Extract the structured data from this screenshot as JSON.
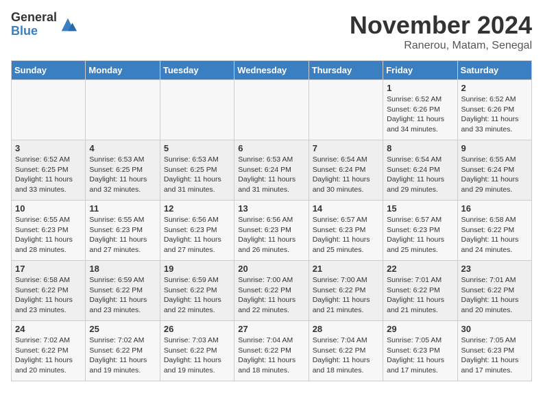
{
  "header": {
    "logo_general": "General",
    "logo_blue": "Blue",
    "month_year": "November 2024",
    "location": "Ranerou, Matam, Senegal"
  },
  "weekdays": [
    "Sunday",
    "Monday",
    "Tuesday",
    "Wednesday",
    "Thursday",
    "Friday",
    "Saturday"
  ],
  "weeks": [
    [
      {
        "day": "",
        "info": ""
      },
      {
        "day": "",
        "info": ""
      },
      {
        "day": "",
        "info": ""
      },
      {
        "day": "",
        "info": ""
      },
      {
        "day": "",
        "info": ""
      },
      {
        "day": "1",
        "info": "Sunrise: 6:52 AM\nSunset: 6:26 PM\nDaylight: 11 hours\nand 34 minutes."
      },
      {
        "day": "2",
        "info": "Sunrise: 6:52 AM\nSunset: 6:26 PM\nDaylight: 11 hours\nand 33 minutes."
      }
    ],
    [
      {
        "day": "3",
        "info": "Sunrise: 6:52 AM\nSunset: 6:25 PM\nDaylight: 11 hours\nand 33 minutes."
      },
      {
        "day": "4",
        "info": "Sunrise: 6:53 AM\nSunset: 6:25 PM\nDaylight: 11 hours\nand 32 minutes."
      },
      {
        "day": "5",
        "info": "Sunrise: 6:53 AM\nSunset: 6:25 PM\nDaylight: 11 hours\nand 31 minutes."
      },
      {
        "day": "6",
        "info": "Sunrise: 6:53 AM\nSunset: 6:24 PM\nDaylight: 11 hours\nand 31 minutes."
      },
      {
        "day": "7",
        "info": "Sunrise: 6:54 AM\nSunset: 6:24 PM\nDaylight: 11 hours\nand 30 minutes."
      },
      {
        "day": "8",
        "info": "Sunrise: 6:54 AM\nSunset: 6:24 PM\nDaylight: 11 hours\nand 29 minutes."
      },
      {
        "day": "9",
        "info": "Sunrise: 6:55 AM\nSunset: 6:24 PM\nDaylight: 11 hours\nand 29 minutes."
      }
    ],
    [
      {
        "day": "10",
        "info": "Sunrise: 6:55 AM\nSunset: 6:23 PM\nDaylight: 11 hours\nand 28 minutes."
      },
      {
        "day": "11",
        "info": "Sunrise: 6:55 AM\nSunset: 6:23 PM\nDaylight: 11 hours\nand 27 minutes."
      },
      {
        "day": "12",
        "info": "Sunrise: 6:56 AM\nSunset: 6:23 PM\nDaylight: 11 hours\nand 27 minutes."
      },
      {
        "day": "13",
        "info": "Sunrise: 6:56 AM\nSunset: 6:23 PM\nDaylight: 11 hours\nand 26 minutes."
      },
      {
        "day": "14",
        "info": "Sunrise: 6:57 AM\nSunset: 6:23 PM\nDaylight: 11 hours\nand 25 minutes."
      },
      {
        "day": "15",
        "info": "Sunrise: 6:57 AM\nSunset: 6:23 PM\nDaylight: 11 hours\nand 25 minutes."
      },
      {
        "day": "16",
        "info": "Sunrise: 6:58 AM\nSunset: 6:22 PM\nDaylight: 11 hours\nand 24 minutes."
      }
    ],
    [
      {
        "day": "17",
        "info": "Sunrise: 6:58 AM\nSunset: 6:22 PM\nDaylight: 11 hours\nand 23 minutes."
      },
      {
        "day": "18",
        "info": "Sunrise: 6:59 AM\nSunset: 6:22 PM\nDaylight: 11 hours\nand 23 minutes."
      },
      {
        "day": "19",
        "info": "Sunrise: 6:59 AM\nSunset: 6:22 PM\nDaylight: 11 hours\nand 22 minutes."
      },
      {
        "day": "20",
        "info": "Sunrise: 7:00 AM\nSunset: 6:22 PM\nDaylight: 11 hours\nand 22 minutes."
      },
      {
        "day": "21",
        "info": "Sunrise: 7:00 AM\nSunset: 6:22 PM\nDaylight: 11 hours\nand 21 minutes."
      },
      {
        "day": "22",
        "info": "Sunrise: 7:01 AM\nSunset: 6:22 PM\nDaylight: 11 hours\nand 21 minutes."
      },
      {
        "day": "23",
        "info": "Sunrise: 7:01 AM\nSunset: 6:22 PM\nDaylight: 11 hours\nand 20 minutes."
      }
    ],
    [
      {
        "day": "24",
        "info": "Sunrise: 7:02 AM\nSunset: 6:22 PM\nDaylight: 11 hours\nand 20 minutes."
      },
      {
        "day": "25",
        "info": "Sunrise: 7:02 AM\nSunset: 6:22 PM\nDaylight: 11 hours\nand 19 minutes."
      },
      {
        "day": "26",
        "info": "Sunrise: 7:03 AM\nSunset: 6:22 PM\nDaylight: 11 hours\nand 19 minutes."
      },
      {
        "day": "27",
        "info": "Sunrise: 7:04 AM\nSunset: 6:22 PM\nDaylight: 11 hours\nand 18 minutes."
      },
      {
        "day": "28",
        "info": "Sunrise: 7:04 AM\nSunset: 6:22 PM\nDaylight: 11 hours\nand 18 minutes."
      },
      {
        "day": "29",
        "info": "Sunrise: 7:05 AM\nSunset: 6:23 PM\nDaylight: 11 hours\nand 17 minutes."
      },
      {
        "day": "30",
        "info": "Sunrise: 7:05 AM\nSunset: 6:23 PM\nDaylight: 11 hours\nand 17 minutes."
      }
    ]
  ]
}
